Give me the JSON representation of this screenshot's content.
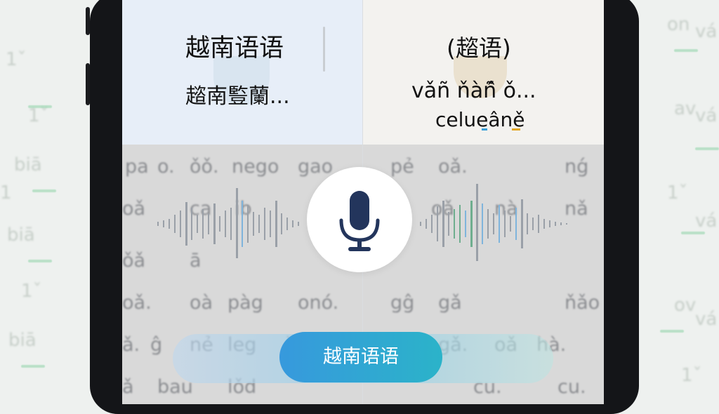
{
  "source": {
    "title": "越南语语",
    "text": "趦南䜿蘭..."
  },
  "target": {
    "title": "(趦语)",
    "text": "vǎñ ňàñ̂ ǒ...",
    "subtext": "celueâně"
  },
  "language_button": {
    "label": "越南语语"
  },
  "icons": {
    "mic": "microphone-icon"
  },
  "colors": {
    "accent_start": "#3799dd",
    "accent_end": "#2bb3c9",
    "mic": "#23355c"
  }
}
